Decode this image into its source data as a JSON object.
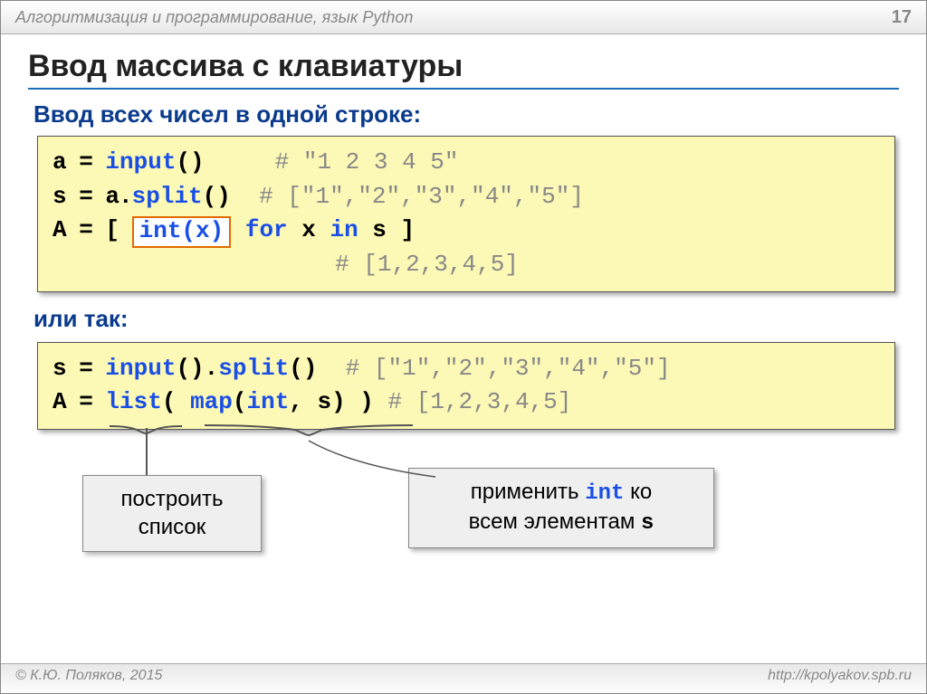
{
  "header": {
    "title": "Алгоритмизация и программирование, язык Python",
    "page": "17"
  },
  "main_title": "Ввод массива с клавиатуры",
  "subtitle": "Ввод всех чисел в одной строке:",
  "or_text": "или так:",
  "code1": {
    "l1a": "a = ",
    "l1b": "input",
    "l1c": "()     ",
    "l1d": "# \"1 2 3 4 5\"",
    "l2a": "s = a.",
    "l2b": "split",
    "l2c": "()  ",
    "l2d": "# [\"1\",\"2\",\"3\",\"4\",\"5\"]",
    "l3a": "A = [ ",
    "l3frame": "int(x)",
    "l3b": " for",
    "l3c": " x ",
    "l3d": "in",
    "l3e": " s ]",
    "l4pad": "                    ",
    "l4": "# [1,2,3,4,5]"
  },
  "code2": {
    "l1a": "s = ",
    "l1b": "input",
    "l1c": "().",
    "l1d": "split",
    "l1e": "()  ",
    "l1f": "# [\"1\",\"2\",\"3\",\"4\",\"5\"]",
    "l2a": "A = ",
    "l2b": "list",
    "l2c": "( ",
    "l2d": "map",
    "l2e": "(",
    "l2f": "int",
    "l2g": ", s) ) ",
    "l2h": "# [1,2,3,4,5]"
  },
  "callout1": "построить\nсписок",
  "callout2_a": "применить ",
  "callout2_int": "int",
  "callout2_b": " ко\nвсем элементам ",
  "callout2_s": "s",
  "footer": {
    "left": "© К.Ю. Поляков, 2015",
    "right": "http://kpolyakov.spb.ru"
  }
}
